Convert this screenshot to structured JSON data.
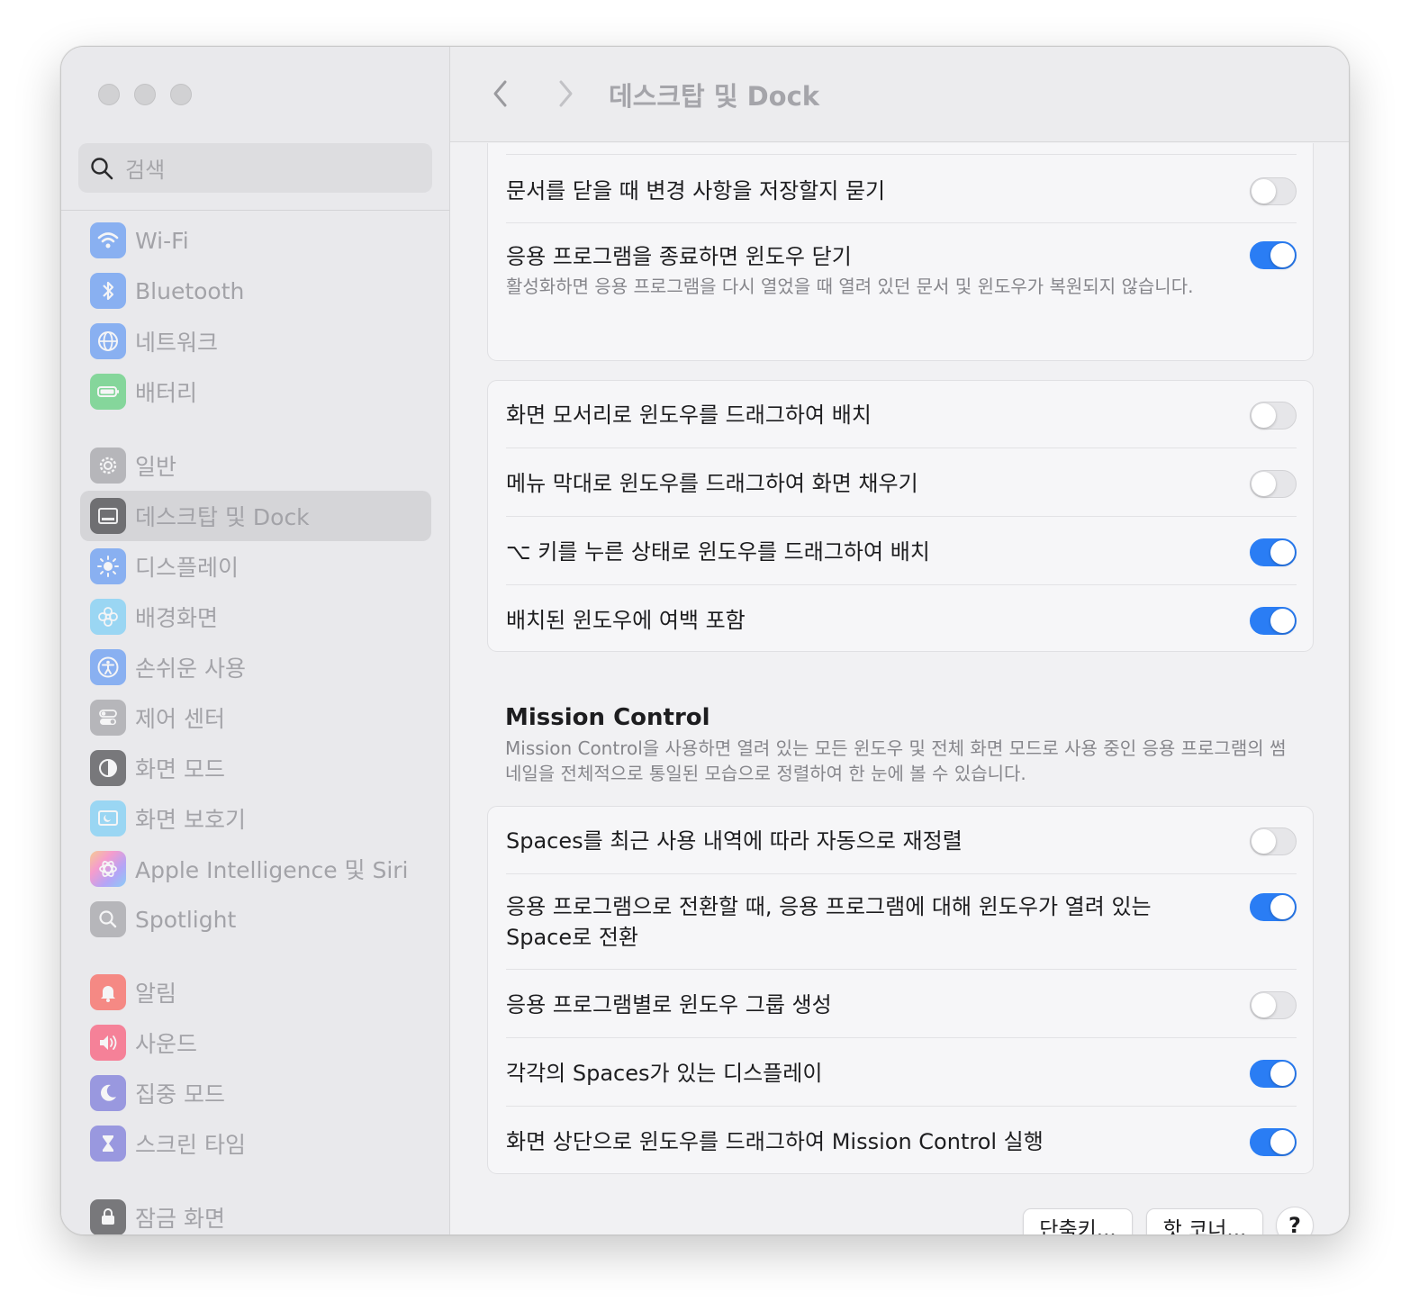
{
  "window": {
    "title": "데스크탑 및 Dock"
  },
  "search": {
    "placeholder": "검색"
  },
  "sidebar": {
    "items": [
      {
        "label": "Wi-Fi",
        "icon": "wifi-icon",
        "color": "#3b82f6"
      },
      {
        "label": "Bluetooth",
        "icon": "bluetooth-icon",
        "color": "#3b82f6"
      },
      {
        "label": "네트워크",
        "icon": "globe-icon",
        "color": "#3b82f6"
      },
      {
        "label": "배터리",
        "icon": "battery-icon",
        "color": "#34c759"
      },
      {
        "label": "일반",
        "icon": "gear-icon",
        "color": "#8e8e93"
      },
      {
        "label": "데스크탑 및 Dock",
        "icon": "dock-icon",
        "color": "#1d1d1f",
        "selected": true
      },
      {
        "label": "디스플레이",
        "icon": "sun-icon",
        "color": "#3b82f6"
      },
      {
        "label": "배경화면",
        "icon": "flower-icon",
        "color": "#5ac8fa"
      },
      {
        "label": "손쉬운 사용",
        "icon": "accessibility-icon",
        "color": "#3b82f6"
      },
      {
        "label": "제어 센터",
        "icon": "toggles-icon",
        "color": "#8e8e93"
      },
      {
        "label": "화면 모드",
        "icon": "appearance-icon",
        "color": "#1d1d1f"
      },
      {
        "label": "화면 보호기",
        "icon": "screensaver-icon",
        "color": "#5ac8fa"
      },
      {
        "label": "Apple Intelligence 및 Siri",
        "icon": "siri-icon",
        "color": "#ff6fb5"
      },
      {
        "label": "Spotlight",
        "icon": "magnifier-icon",
        "color": "#8e8e93"
      },
      {
        "label": "알림",
        "icon": "bell-icon",
        "color": "#ff3b30"
      },
      {
        "label": "사운드",
        "icon": "speaker-icon",
        "color": "#ff2d55"
      },
      {
        "label": "집중 모드",
        "icon": "moon-icon",
        "color": "#5856d6"
      },
      {
        "label": "스크린 타임",
        "icon": "hourglass-icon",
        "color": "#5856d6"
      },
      {
        "label": "잠금 화면",
        "icon": "lock-icon",
        "color": "#1d1d1f"
      }
    ]
  },
  "settings": {
    "group1": [
      {
        "label": "문서를 닫을 때 변경 사항을 저장할지 묻기",
        "on": false
      },
      {
        "label": "응용 프로그램을 종료하면 윈도우 닫기",
        "sub": "활성화하면 응용 프로그램을 다시 열었을 때 열려 있던 문서 및 윈도우가 복원되지 않습니다.",
        "on": true
      }
    ],
    "group2": [
      {
        "label": "화면 모서리로 윈도우를 드래그하여 배치",
        "on": false
      },
      {
        "label": "메뉴 막대로 윈도우를 드래그하여 화면 채우기",
        "on": false
      },
      {
        "label": "⌥ 키를 누른 상태로 윈도우를 드래그하여 배치",
        "on": true
      },
      {
        "label": "배치된 윈도우에 여백 포함",
        "on": true
      }
    ],
    "mission_control": {
      "title": "Mission Control",
      "desc": "Mission Control을 사용하면 열려 있는 모든 윈도우 및 전체 화면 모드로 사용 중인 응용 프로그램의 썸네일을 전체적으로 통일된 모습으로 정렬하여 한 눈에 볼 수 있습니다."
    },
    "group3": [
      {
        "label": "Spaces를 최근 사용 내역에 따라 자동으로 재정렬",
        "on": false
      },
      {
        "label": "응용 프로그램으로 전환할 때, 응용 프로그램에 대해 윈도우가 열려 있는",
        "label2": "Space로 전환",
        "on": true
      },
      {
        "label": "응용 프로그램별로 윈도우 그룹 생성",
        "on": false
      },
      {
        "label": "각각의 Spaces가 있는 디스플레이",
        "on": true
      },
      {
        "label": "화면 상단으로 윈도우를 드래그하여 Mission Control 실행",
        "on": true
      }
    ]
  },
  "footer": {
    "shortcuts": "단축키...",
    "hot_corners": "핫 코너...",
    "help": "?"
  },
  "colors": {
    "accent": "#2a7df4"
  }
}
